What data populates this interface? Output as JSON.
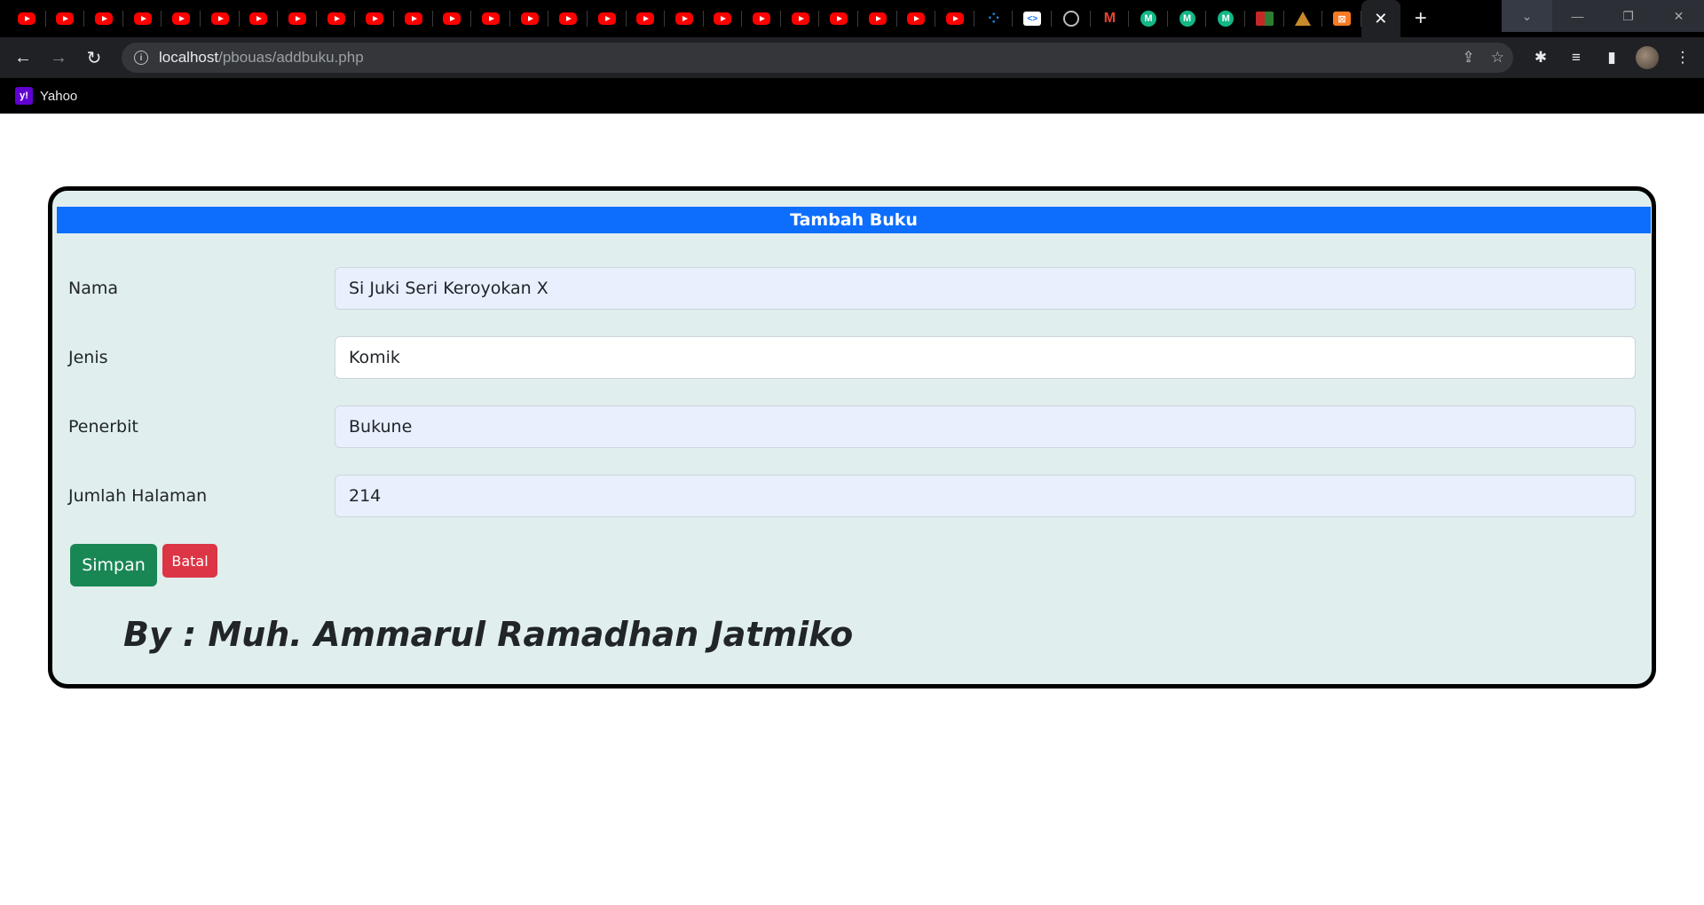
{
  "browser": {
    "tab_count_youtube": 25,
    "active_tab_close": "✕",
    "new_tab": "+",
    "url_host": "localhost",
    "url_path": "/pbouas/addbuku.php",
    "bookmarks": [
      {
        "label": "Yahoo",
        "icon": "yahoo-icon"
      }
    ]
  },
  "form": {
    "title": "Tambah Buku",
    "fields": [
      {
        "label": "Nama",
        "value": "Si Juki Seri Keroyokan X"
      },
      {
        "label": "Jenis",
        "value": "Komik"
      },
      {
        "label": "Penerbit",
        "value": "Bukune"
      },
      {
        "label": "Jumlah Halaman",
        "value": "214"
      }
    ],
    "save_label": "Simpan",
    "cancel_label": "Batal",
    "author": "By : Muh. Ammarul Ramadhan Jatmiko"
  },
  "colors": {
    "header_bg": "#0d6efd",
    "save_bg": "#198754",
    "cancel_bg": "#dc3545",
    "card_bg": "#e0eeee"
  }
}
